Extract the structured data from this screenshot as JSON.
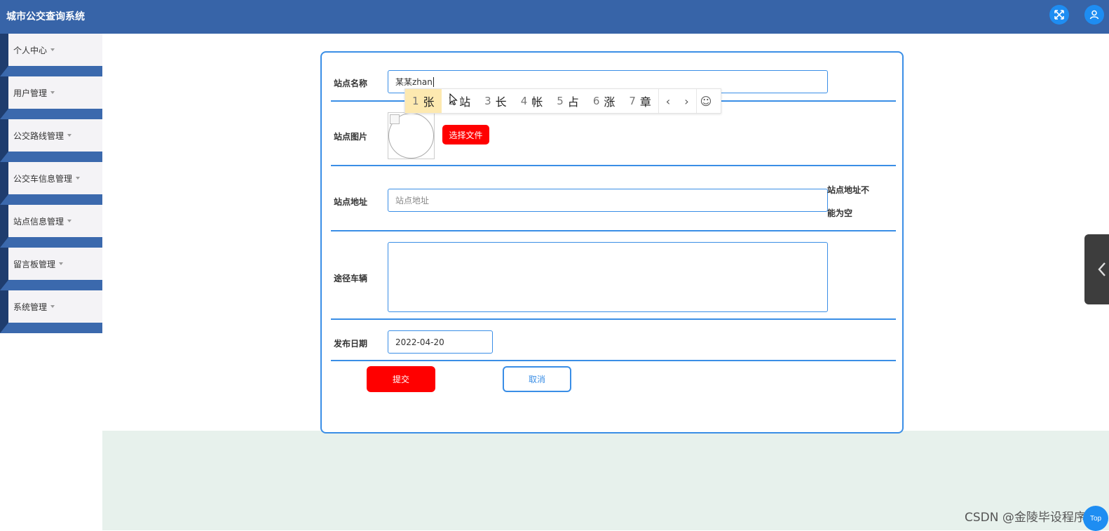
{
  "app": {
    "title": "城市公交查询系统"
  },
  "header": {
    "fullscreen_icon": "expand-icon",
    "user_icon": "user-icon"
  },
  "sidebar": {
    "items": [
      {
        "label": "个人中心"
      },
      {
        "label": "用户管理"
      },
      {
        "label": "公交路线管理"
      },
      {
        "label": "公交车信息管理"
      },
      {
        "label": "站点信息管理"
      },
      {
        "label": "留言板管理"
      },
      {
        "label": "系统管理"
      }
    ]
  },
  "form": {
    "station_name": {
      "label": "站点名称",
      "value": "某某zhan"
    },
    "station_image": {
      "label": "站点图片",
      "button": "选择文件"
    },
    "station_address": {
      "label": "站点地址",
      "placeholder": "站点地址",
      "error_line1": "站点地址不",
      "error_line2": "能为空"
    },
    "route_vehicles": {
      "label": "途径车辆",
      "value": ""
    },
    "publish_date": {
      "label": "发布日期",
      "value": "2022-04-20"
    },
    "submit": "提交",
    "cancel": "取消"
  },
  "ime": {
    "candidates": [
      {
        "num": "1",
        "char": "张"
      },
      {
        "num": "2",
        "char": "站"
      },
      {
        "num": "3",
        "char": "长"
      },
      {
        "num": "4",
        "char": "帐"
      },
      {
        "num": "5",
        "char": "占"
      },
      {
        "num": "6",
        "char": "涨"
      },
      {
        "num": "7",
        "char": "章"
      }
    ],
    "prev": "‹",
    "next": "›",
    "emoji": "☺"
  },
  "watermark": "CSDN @金陵毕设程序",
  "back_to_top": "Top",
  "colors": {
    "header": "#3764a8",
    "accent": "#3a8ee6",
    "danger": "#ff0000",
    "icon_btn": "#1e8df2"
  }
}
